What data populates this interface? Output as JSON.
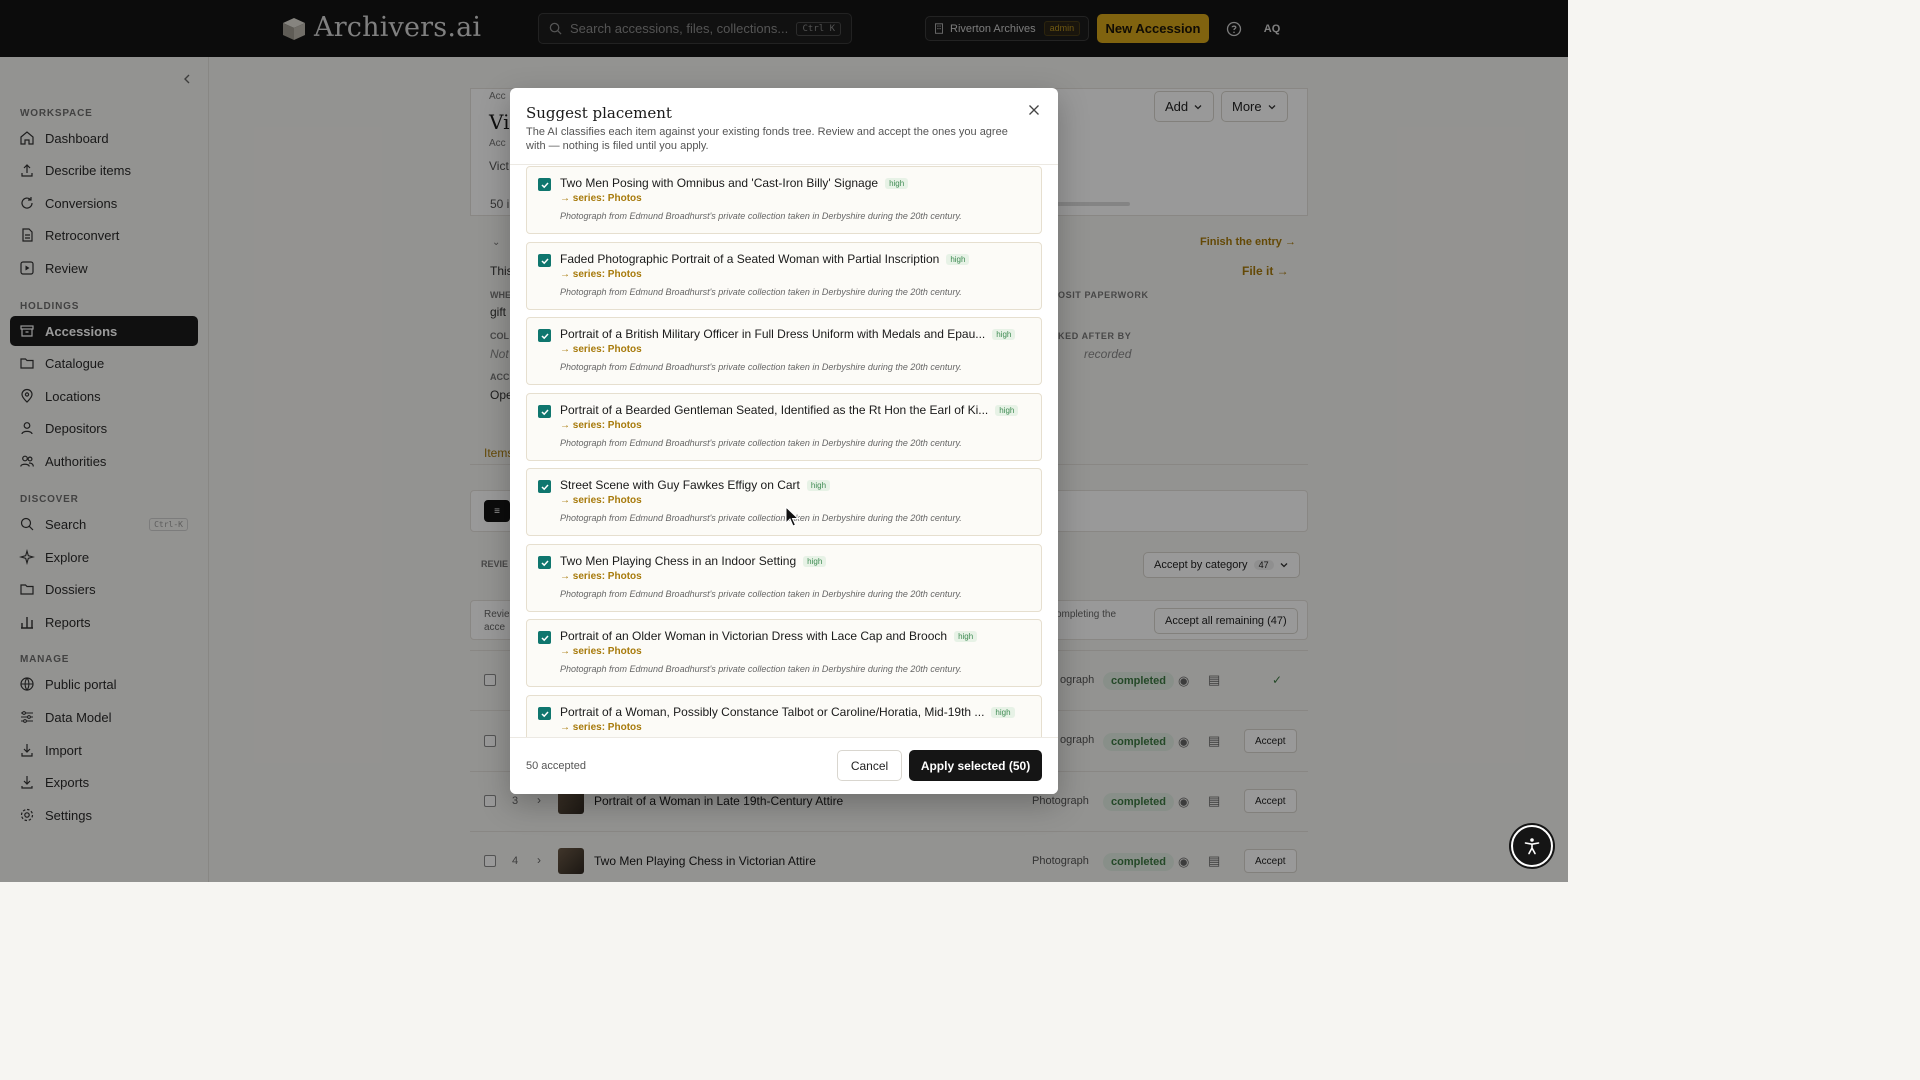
{
  "header": {
    "app_name": "Archivers.ai",
    "search_placeholder": "Search accessions, files, collections...",
    "search_shortcut": "Ctrl K",
    "org_name": "Riverton Archives",
    "org_role": "admin",
    "new_accession_label": "New Accession",
    "avatar_initials": "AQ"
  },
  "sidebar": {
    "sections": [
      {
        "label": "WORKSPACE",
        "items": [
          {
            "label": "Dashboard",
            "icon": "home-icon"
          },
          {
            "label": "Describe items",
            "icon": "upload-icon"
          },
          {
            "label": "Conversions",
            "icon": "refresh-icon"
          },
          {
            "label": "Retroconvert",
            "icon": "document-icon"
          },
          {
            "label": "Review",
            "icon": "play-icon"
          }
        ]
      },
      {
        "label": "HOLDINGS",
        "items": [
          {
            "label": "Accessions",
            "icon": "archive-icon",
            "active": true
          },
          {
            "label": "Catalogue",
            "icon": "folder-icon"
          },
          {
            "label": "Locations",
            "icon": "pin-icon"
          },
          {
            "label": "Depositors",
            "icon": "user-icon"
          },
          {
            "label": "Authorities",
            "icon": "users-icon"
          }
        ]
      },
      {
        "label": "DISCOVER",
        "items": [
          {
            "label": "Search",
            "icon": "search-icon",
            "shortcut": "Ctrl-K"
          },
          {
            "label": "Explore",
            "icon": "sparkle-icon"
          },
          {
            "label": "Dossiers",
            "icon": "folder-icon"
          },
          {
            "label": "Reports",
            "icon": "bar-chart-icon"
          }
        ]
      },
      {
        "label": "MANAGE",
        "items": [
          {
            "label": "Public portal",
            "icon": "globe-icon"
          },
          {
            "label": "Data Model",
            "icon": "sliders-icon"
          },
          {
            "label": "Import",
            "icon": "download-icon"
          },
          {
            "label": "Exports",
            "icon": "export-icon"
          },
          {
            "label": "Settings",
            "icon": "gear-icon"
          }
        ]
      }
    ]
  },
  "background": {
    "breadcrumb": "Acc",
    "title_fragment": "Vi",
    "sub_fragment": "Acc",
    "sub2_fragment": "Vict",
    "count_fragment": "50 i",
    "add_label": "Add",
    "more_label": "More",
    "finish_entry": "Finish the entry →",
    "file_it": "File it →",
    "deposit_paperwork": "OSIT PAPERWORK",
    "ked_after_by": "KED AFTER BY",
    "recorded": "recorded",
    "this_frag": "This",
    "whe_frag": "WHE",
    "gift_frag": "gift",
    "col_frag": "COL",
    "not_frag": "Not",
    "acc_frag": "ACC",
    "ope_frag": "Ope",
    "items_tab": "Items",
    "revie_frag": "REVIE",
    "revie2_frag": "Revie",
    "acce_frag": "acce",
    "completing_frag": "ompleting the",
    "accept_by_category": "Accept by category",
    "accept_by_category_count": "47",
    "accept_all_remaining": "Accept all remaining (47)",
    "rows": [
      {
        "num": "",
        "title": "",
        "type": "ograph",
        "status": "completed",
        "action": "✓"
      },
      {
        "num": "",
        "title": "",
        "type": "ograph",
        "status": "completed",
        "action": "Accept"
      },
      {
        "num": "3",
        "title": "Portrait of a Woman in Late 19th-Century Attire",
        "type": "Photograph",
        "status": "completed",
        "action": "Accept"
      },
      {
        "num": "4",
        "title": "Two Men Playing Chess in Victorian Attire",
        "type": "Photograph",
        "status": "completed",
        "action": "Accept"
      }
    ]
  },
  "modal": {
    "title": "Suggest placement",
    "description": "The AI classifies each item against your existing fonds tree. Review and accept the ones you agree with — nothing is filed until you apply.",
    "items": [
      {
        "title": "Two Men Posing with Omnibus and 'Cast-Iron Billy' Signage",
        "confidence": "high",
        "series": "→ series: Photos",
        "description": "Photograph from Edmund Broadhurst's private collection taken in Derbyshire during the 20th century."
      },
      {
        "title": "Faded Photographic Portrait of a Seated Woman with Partial Inscription",
        "confidence": "high",
        "series": "→ series: Photos",
        "description": "Photograph from Edmund Broadhurst's private collection taken in Derbyshire during the 20th century."
      },
      {
        "title": "Portrait of a British Military Officer in Full Dress Uniform with Medals and Epau...",
        "confidence": "high",
        "series": "→ series: Photos",
        "description": "Photograph from Edmund Broadhurst's private collection taken in Derbyshire during the 20th century."
      },
      {
        "title": "Portrait of a Bearded Gentleman Seated, Identified as the Rt Hon the Earl of Ki...",
        "confidence": "high",
        "series": "→ series: Photos",
        "description": "Photograph from Edmund Broadhurst's private collection taken in Derbyshire during the 20th century."
      },
      {
        "title": "Street Scene with Guy Fawkes Effigy on Cart",
        "confidence": "high",
        "series": "→ series: Photos",
        "description": "Photograph from Edmund Broadhurst's private collection taken in Derbyshire during the 20th century."
      },
      {
        "title": "Two Men Playing Chess in an Indoor Setting",
        "confidence": "high",
        "series": "→ series: Photos",
        "description": "Photograph from Edmund Broadhurst's private collection taken in Derbyshire during the 20th century."
      },
      {
        "title": "Portrait of an Older Woman in Victorian Dress with Lace Cap and Brooch",
        "confidence": "high",
        "series": "→ series: Photos",
        "description": "Photograph from Edmund Broadhurst's private collection taken in Derbyshire during the 20th century."
      },
      {
        "title": "Portrait of a Woman, Possibly Constance Talbot or Caroline/Horatia, Mid-19th ...",
        "confidence": "high",
        "series": "→ series: Photos",
        "description": ""
      }
    ],
    "accepted_count": "50 accepted",
    "cancel_label": "Cancel",
    "apply_label": "Apply selected (50)"
  },
  "colors": {
    "accent": "#d6a51a",
    "dark": "#151515",
    "check": "#0f766e",
    "series": "#a77a0b"
  }
}
